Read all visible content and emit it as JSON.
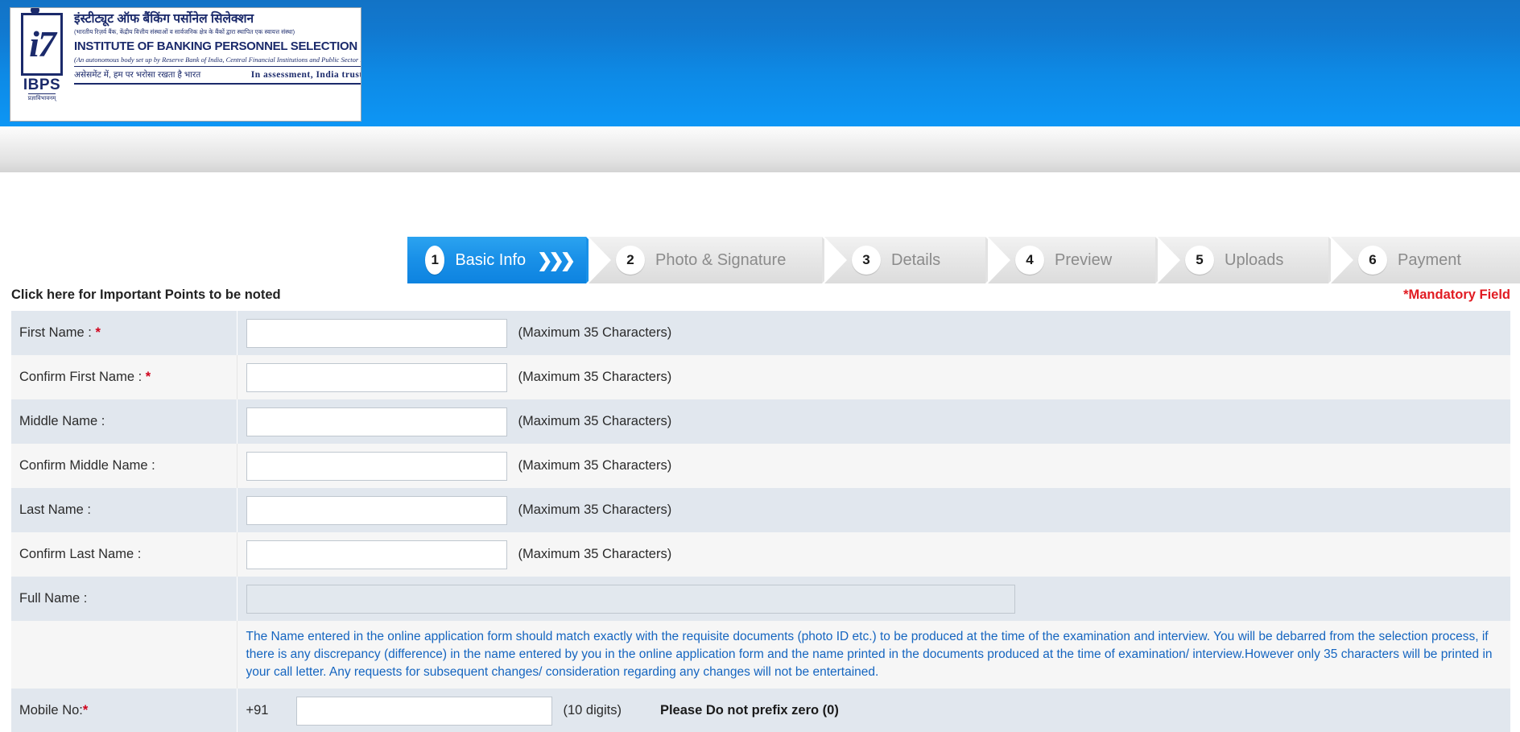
{
  "header": {
    "logo": {
      "hindi_title": "इंस्टीट्यूट ऑफ बैंकिंग पर्सोनेल सिलेक्शन",
      "hindi_subtitle": "(भारतीय रिज़र्व बैंक, केंद्रीय वित्तीय संस्थाओं व सार्वजनिक क्षेत्र के बैंकों द्वारा स्थापित एक स्वायत्त संस्था)",
      "english_title": "INSTITUTE OF BANKING PERSONNEL SELECTION",
      "english_subtitle": "(An autonomous body set up by Reserve Bank of India, Central Financial Institutions and Public Sector Banks)",
      "hindi_tagline": "असेसमेंट में, हम पर भरोसा रखता है भारत",
      "english_tagline": "In assessment, India trusts us",
      "mark_text": "i7",
      "mark_label": "IBPS",
      "mark_motto": "प्रज्ञाविभावनम्"
    }
  },
  "steps": [
    {
      "num": "1",
      "label": "Basic Info",
      "active": true,
      "chevrons": "❯❯❯"
    },
    {
      "num": "2",
      "label": "Photo & Signature",
      "active": false,
      "chevrons": ""
    },
    {
      "num": "3",
      "label": "Details",
      "active": false,
      "chevrons": ""
    },
    {
      "num": "4",
      "label": "Preview",
      "active": false,
      "chevrons": ""
    },
    {
      "num": "5",
      "label": "Uploads",
      "active": false,
      "chevrons": ""
    },
    {
      "num": "6",
      "label": "Payment",
      "active": false,
      "chevrons": ""
    }
  ],
  "subheader": {
    "important_points": "Click here for Important Points to be noted",
    "mandatory_field": "*Mandatory Field"
  },
  "form": {
    "max_chars_hint": "(Maximum 35 Characters)",
    "rows": [
      {
        "label": "First Name : ",
        "required": true,
        "value": "",
        "hint": "(Maximum 35 Characters)"
      },
      {
        "label": "Confirm First Name : ",
        "required": true,
        "value": "",
        "hint": "(Maximum 35 Characters)"
      },
      {
        "label": "Middle Name :",
        "required": false,
        "value": "",
        "hint": "(Maximum 35 Characters)"
      },
      {
        "label": "Confirm Middle Name :",
        "required": false,
        "value": "",
        "hint": "(Maximum 35 Characters)"
      },
      {
        "label": "Last Name :",
        "required": false,
        "value": "",
        "hint": "(Maximum 35 Characters)"
      },
      {
        "label": "Confirm Last Name :",
        "required": false,
        "value": "",
        "hint": "(Maximum 35 Characters)"
      }
    ],
    "full_name": {
      "label": "Full Name :",
      "value": ""
    },
    "note": "The Name entered in the online application form should match exactly with the requisite documents (photo ID etc.) to be produced at the time of the examination and interview. You will be debarred from the selection process, if there is any discrepancy (difference) in the name entered by you in the online application form and the name printed in the documents produced at the time of examination/ interview.However only 35 characters will be printed in your call letter. Any requests for subsequent changes/ consideration regarding any changes will not be entertained.",
    "mobile": {
      "label": "Mobile No:",
      "required": true,
      "country_code": "+91",
      "value": "",
      "hint": "(10 digits)",
      "warning": "Please Do not prefix zero (0)"
    }
  },
  "colors": {
    "header_blue": "#0d8ae6",
    "active_step": "#1a91e8",
    "mandatory_red": "#e11b22",
    "note_blue": "#1565c0",
    "row_odd": "#e1e7ee",
    "row_even": "#f6f6f6"
  }
}
